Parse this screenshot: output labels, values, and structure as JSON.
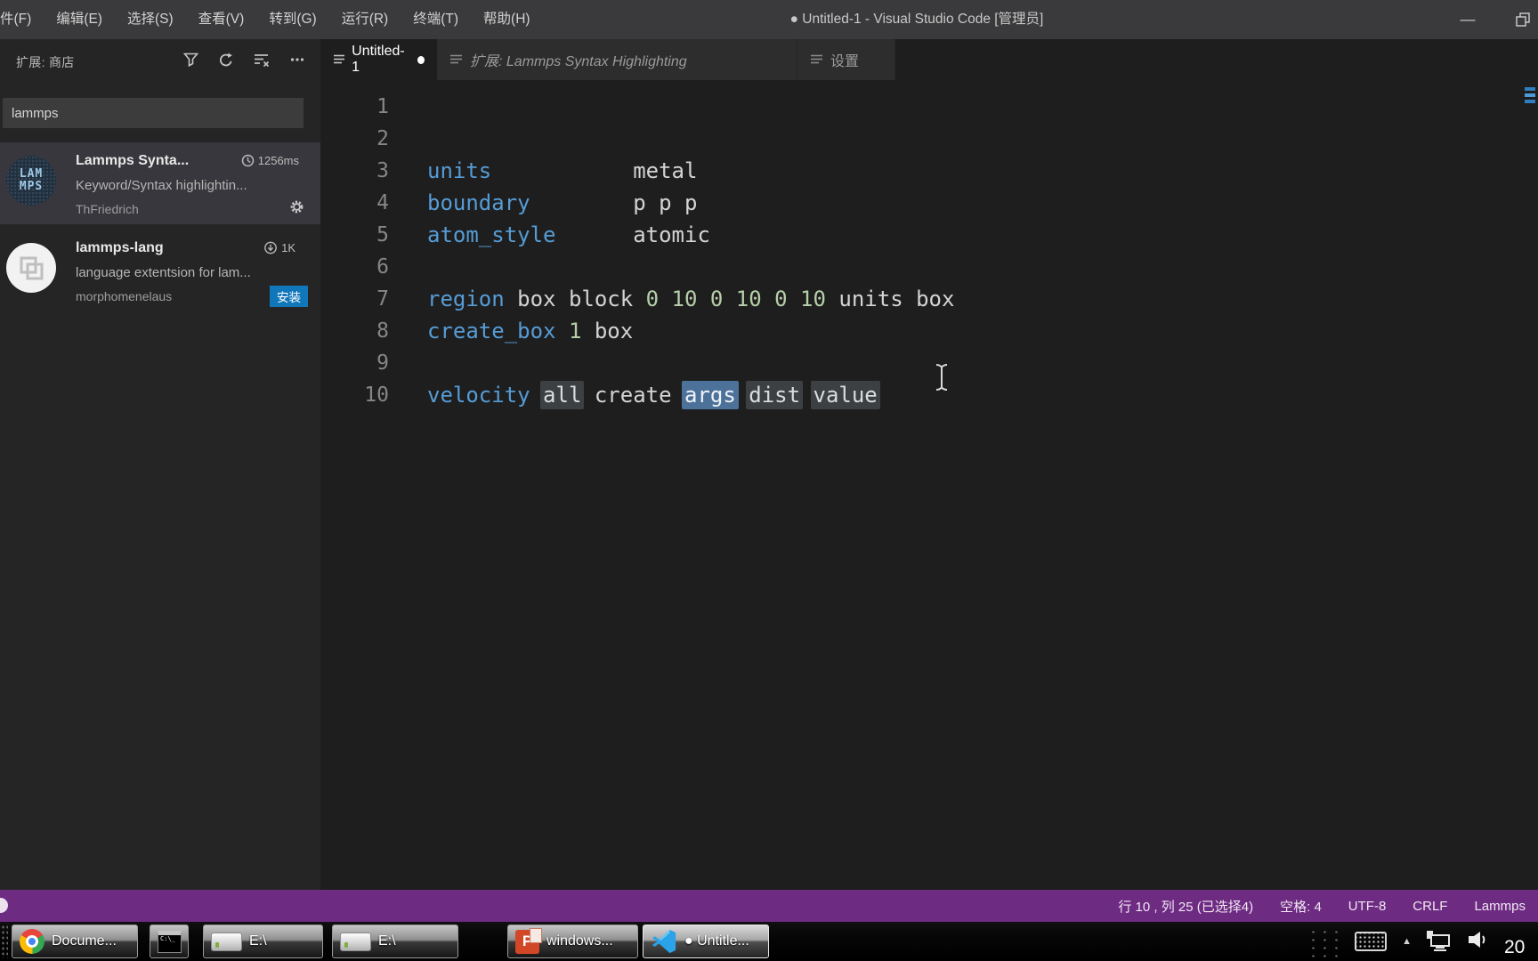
{
  "titlebar": {
    "title": "● Untitled-1 - Visual Studio Code [管理员]",
    "menus": [
      "件(F)",
      "编辑(E)",
      "选择(S)",
      "查看(V)",
      "转到(G)",
      "运行(R)",
      "终端(T)",
      "帮助(H)"
    ]
  },
  "sidebar": {
    "header": {
      "title": "扩展: 商店"
    },
    "search": {
      "value": "lammps"
    },
    "extensions": [
      {
        "name": "Lammps Synta...",
        "badge": "1256ms",
        "description": "Keyword/Syntax highlightin...",
        "author": "ThFriedrich",
        "logo_line1": "LAM",
        "logo_line2": "MPS"
      },
      {
        "name": "lammps-lang",
        "badge": "1K",
        "description": "language extentsion for lam...",
        "author": "morphomenelaus",
        "install_label": "安装"
      }
    ]
  },
  "tabs": [
    {
      "label": "Untitled-1",
      "modified": true
    },
    {
      "label": "扩展: Lammps Syntax Highlighting",
      "preview": true
    },
    {
      "label": "设置"
    }
  ],
  "editor": {
    "language": "lammps",
    "lines": [
      {
        "num": "1",
        "tokens": []
      },
      {
        "num": "2",
        "tokens": []
      },
      {
        "num": "3",
        "tokens": [
          {
            "t": "units",
            "y": "kw"
          },
          {
            "t": "           metal",
            "y": "txt"
          }
        ]
      },
      {
        "num": "4",
        "tokens": [
          {
            "t": "boundary",
            "y": "kw"
          },
          {
            "t": "        p p p",
            "y": "txt"
          }
        ]
      },
      {
        "num": "5",
        "tokens": [
          {
            "t": "atom_style",
            "y": "kw"
          },
          {
            "t": "      atomic",
            "y": "txt"
          }
        ]
      },
      {
        "num": "6",
        "tokens": []
      },
      {
        "num": "7",
        "tokens": [
          {
            "t": "region",
            "y": "kw"
          },
          {
            "t": " box block ",
            "y": "txt"
          },
          {
            "t": "0 10 0 10 0 10",
            "y": "num"
          },
          {
            "t": " units box",
            "y": "txt"
          }
        ]
      },
      {
        "num": "8",
        "tokens": [
          {
            "t": "create_box",
            "y": "kw"
          },
          {
            "t": " ",
            "y": "txt"
          },
          {
            "t": "1",
            "y": "num"
          },
          {
            "t": " box",
            "y": "txt"
          }
        ]
      },
      {
        "num": "9",
        "tokens": []
      },
      {
        "num": "10",
        "tokens": [
          {
            "t": "velocity",
            "y": "kw"
          },
          {
            "t": " ",
            "y": "txt"
          },
          {
            "t": "all",
            "y": "ph"
          },
          {
            "t": " create ",
            "y": "txt"
          },
          {
            "t": "",
            "y": "caret"
          },
          {
            "t": "args",
            "y": "sel"
          },
          {
            "t": " ",
            "y": "txt"
          },
          {
            "t": "dist",
            "y": "ph"
          },
          {
            "t": " ",
            "y": "txt"
          },
          {
            "t": "value",
            "y": "ph"
          }
        ]
      }
    ]
  },
  "statusbar": {
    "items": [
      "行 10 , 列 25 (已选择4)",
      "空格: 4",
      "UTF-8",
      "CRLF",
      "Lammps"
    ]
  },
  "taskbar": {
    "buttons": [
      {
        "icon": "chrome",
        "label": "Docume..."
      },
      {
        "icon": "cmd",
        "label": ""
      },
      {
        "icon": "drive",
        "label": "E:\\"
      },
      {
        "icon": "drive",
        "label": "E:\\"
      },
      {
        "icon": "powerpoint",
        "label": "windows..."
      },
      {
        "icon": "vscode",
        "label": "● Untitle...",
        "active": true
      }
    ],
    "tray": {
      "clock": "20"
    }
  },
  "colors": {
    "statusbar_background": "#6E2B82",
    "keyword": "#569CD6",
    "number": "#B5CEA8",
    "code_text": "#D4D4D4",
    "snippet_selection": "#4D7299",
    "snippet_placeholder": "#3D4043",
    "install_button": "#1177BB",
    "titlebar_background": "#3A3A3C",
    "sidebar_background": "#252526",
    "editor_background": "#1E1E1E"
  }
}
